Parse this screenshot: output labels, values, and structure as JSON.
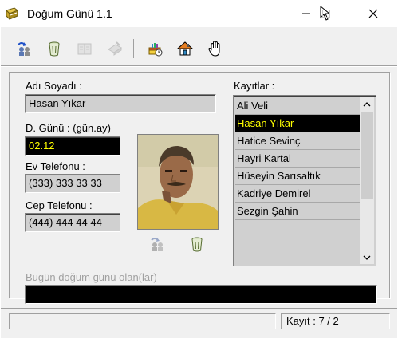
{
  "window": {
    "title": "Doğum Günü 1.1"
  },
  "toolbar": {
    "buttons": [
      {
        "icon": "people-transfer-icon",
        "enabled": true
      },
      {
        "icon": "trash-icon",
        "enabled": true
      },
      {
        "icon": "book-icon",
        "enabled": false
      },
      {
        "icon": "delete-arrow-icon",
        "enabled": false
      },
      {
        "icon": "birthday-cake-icon",
        "enabled": true
      },
      {
        "icon": "home-icon",
        "enabled": true
      },
      {
        "icon": "hand-stop-icon",
        "enabled": true
      }
    ]
  },
  "form": {
    "name_label": "Adı Soyadı :",
    "name_value": "Hasan Yıkar",
    "birthday_label": "D. Günü : (gün.ay)",
    "birthday_value": "02.12",
    "home_phone_label": "Ev Telefonu :",
    "home_phone_value": "(333) 333 33 33",
    "mobile_label": "Cep Telefonu :",
    "mobile_value": "(444) 444 44 44"
  },
  "records": {
    "label": "Kayıtlar :",
    "items": [
      "Ali Veli",
      "Hasan Yıkar",
      "Hatice Sevinç",
      "Hayri Kartal",
      "Hüseyin Sarısaltık",
      "Kadriye Demirel",
      "Sezgin Şahin"
    ],
    "selected_index": 1
  },
  "today": {
    "label": "Bugün doğum günü olan(lar)",
    "value": ""
  },
  "status": {
    "left": "",
    "record_count": "Kayıt : 7 / 2"
  },
  "colors": {
    "highlight_bg": "#000000",
    "highlight_text": "#ffff00",
    "field_bg": "#d0d0d0",
    "window_bg": "#f0f0f0"
  }
}
